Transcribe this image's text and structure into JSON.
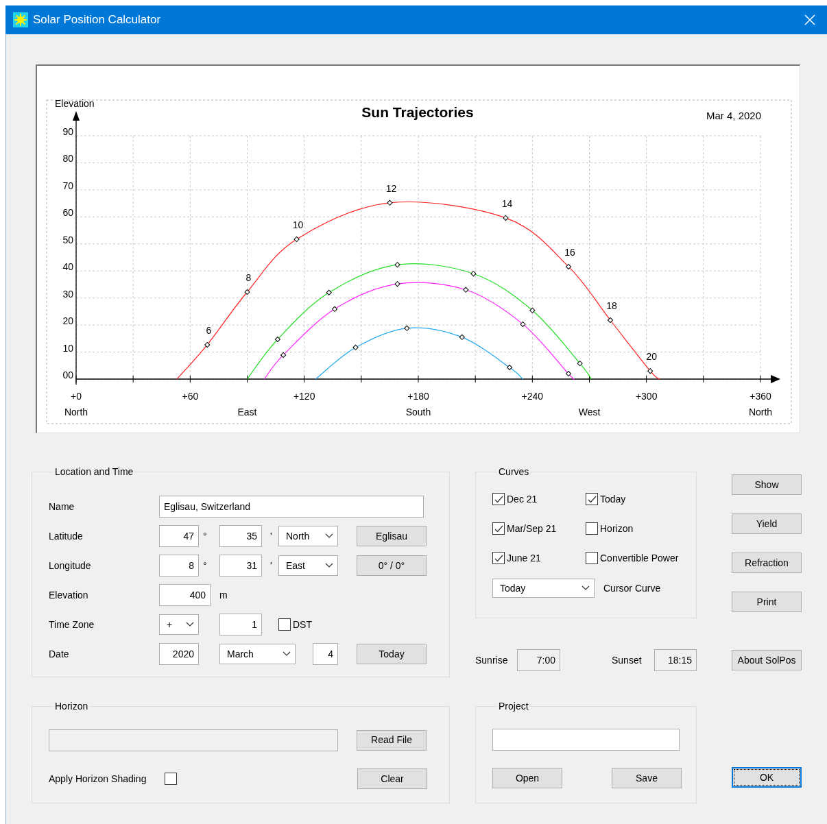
{
  "window": {
    "title": "Solar Position Calculator"
  },
  "chart": {
    "date": "Mar 4, 2020",
    "directions": [
      {
        "label": "North"
      },
      {
        "label": "East"
      },
      {
        "label": "South"
      },
      {
        "label": "West"
      },
      {
        "label": "North"
      }
    ],
    "chart_data": {
      "type": "line",
      "title": "Sun Trajectories",
      "ylabel": "Elevation",
      "xlim": [
        0,
        360
      ],
      "ylim": [
        0,
        90
      ],
      "grid": true,
      "xticks": [
        {
          "value": 0,
          "label": "+0"
        },
        {
          "value": 60,
          "label": "+60"
        },
        {
          "value": 120,
          "label": "+120"
        },
        {
          "value": 180,
          "label": "+180"
        },
        {
          "value": 240,
          "label": "+240"
        },
        {
          "value": 300,
          "label": "+300"
        },
        {
          "value": 360,
          "label": "+360"
        }
      ],
      "yticks": [
        {
          "value": 0,
          "label": "00"
        },
        10,
        20,
        30,
        40,
        50,
        60,
        70,
        80,
        90
      ],
      "x": [
        53,
        69,
        90,
        99,
        106,
        109,
        116,
        126,
        133,
        136,
        147,
        165,
        169,
        174,
        203,
        205,
        209,
        226,
        228,
        235,
        240,
        259,
        262,
        265,
        271,
        281,
        302,
        307
      ],
      "series": [
        {
          "color": "#ff2020",
          "marker": true,
          "values": [
            0,
            12.7,
            32.2,
            null,
            null,
            null,
            51.7,
            null,
            null,
            null,
            null,
            65.2,
            null,
            null,
            null,
            null,
            null,
            59.6,
            null,
            null,
            null,
            41.6,
            null,
            null,
            null,
            21.8,
            3,
            0
          ]
        },
        {
          "color": "#20e020",
          "marker": true,
          "values": [
            null,
            null,
            0,
            null,
            14.7,
            null,
            null,
            null,
            32,
            null,
            null,
            null,
            42.3,
            null,
            null,
            null,
            39,
            null,
            null,
            null,
            25.4,
            null,
            null,
            5.8,
            0,
            null,
            null,
            null
          ]
        },
        {
          "color": "#ff20ff",
          "marker": true,
          "values": [
            null,
            null,
            null,
            0,
            null,
            8.9,
            null,
            null,
            null,
            25.9,
            null,
            null,
            35.2,
            null,
            null,
            33,
            null,
            null,
            null,
            20.3,
            null,
            2,
            0,
            null,
            null,
            null,
            null,
            null
          ]
        },
        {
          "color": "#20a8f0",
          "marker": true,
          "values": [
            null,
            null,
            null,
            null,
            null,
            null,
            null,
            0,
            null,
            null,
            11.7,
            null,
            null,
            18.8,
            15.5,
            null,
            null,
            null,
            4.3,
            0,
            null,
            null,
            null,
            null,
            null,
            null,
            null,
            null
          ]
        }
      ],
      "annotations": [
        {
          "x": 69,
          "y": 12.7,
          "text": "6"
        },
        {
          "x": 90,
          "y": 32.2,
          "text": "8"
        },
        {
          "x": 116,
          "y": 51.7,
          "text": "10"
        },
        {
          "x": 165,
          "y": 65.2,
          "text": "12"
        },
        {
          "x": 226,
          "y": 59.6,
          "text": "14"
        },
        {
          "x": 259,
          "y": 41.6,
          "text": "16"
        },
        {
          "x": 281,
          "y": 21.8,
          "text": "18"
        },
        {
          "x": 302,
          "y": 3,
          "text": "20"
        }
      ]
    }
  },
  "location": {
    "title": "Location and Time",
    "name": {
      "label": "Name",
      "value": "Eglisau, Switzerland"
    },
    "latitude": {
      "label": "Latitude",
      "degrees": "47",
      "degree_sign": "°",
      "minutes": "35",
      "minute_sign": "'",
      "direction": "North",
      "button": "Eglisau"
    },
    "longitude": {
      "label": "Longitude",
      "degrees": "8",
      "degree_sign": "°",
      "minutes": "31",
      "minute_sign": "'",
      "direction": "East",
      "button": "0° / 0°"
    },
    "elevation": {
      "label": "Elevation",
      "value": "400",
      "unit": "m"
    },
    "time_zone": {
      "label": "Time Zone",
      "sign": "+",
      "hours": "1",
      "dst": {
        "label": "DST",
        "checked": false
      }
    },
    "date": {
      "label": "Date",
      "year": "2020",
      "month": "March",
      "day": "4",
      "button": "Today"
    }
  },
  "curves": {
    "title": "Curves",
    "options": [
      {
        "label": "Dec 21",
        "checked": true
      },
      {
        "label": "Today",
        "checked": true
      },
      {
        "label": "Mar/Sep 21",
        "checked": true
      },
      {
        "label": "Horizon",
        "checked": false
      },
      {
        "label": "June 21",
        "checked": true
      },
      {
        "label": "Convertible Power",
        "checked": false
      }
    ],
    "cursor_curve": {
      "value": "Today",
      "label": "Cursor Curve"
    }
  },
  "sun_times": {
    "sunrise_label": "Sunrise",
    "sunrise": "7:00",
    "sunset_label": "Sunset",
    "sunset": "18:15"
  },
  "side_buttons": [
    {
      "label": "Show"
    },
    {
      "label": "Yield"
    },
    {
      "label": "Refraction"
    },
    {
      "label": "Print"
    },
    {
      "label": "About SolPos"
    }
  ],
  "horizon": {
    "title": "Horizon",
    "file_field_disabled": true,
    "read_button": "Read File",
    "clear_button": "Clear",
    "shading": {
      "label": "Apply Horizon Shading",
      "checked": false
    }
  },
  "project": {
    "title": "Project",
    "open_button": "Open",
    "save_button": "Save"
  },
  "ok_button": {
    "label": "OK",
    "default": true
  }
}
